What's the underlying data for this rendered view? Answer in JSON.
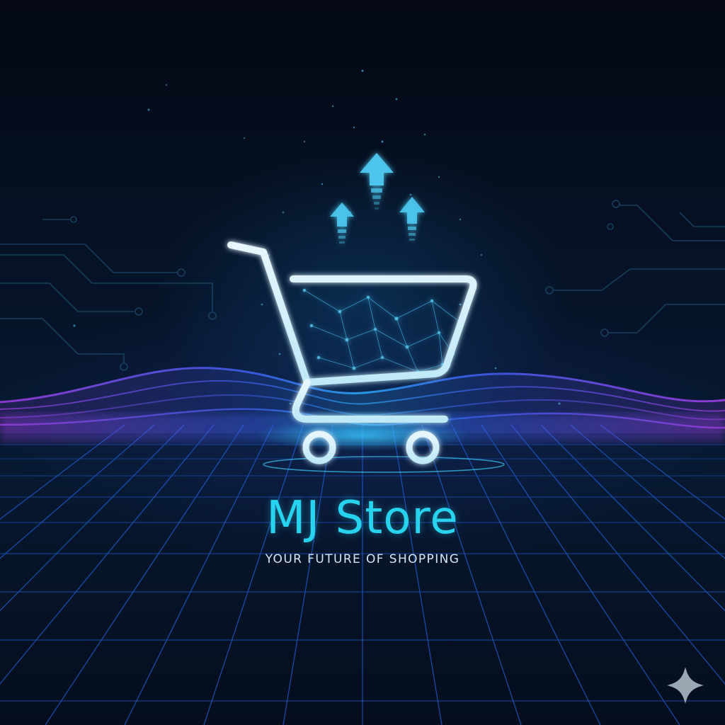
{
  "brand": {
    "name": "MJ Store",
    "tagline": "YOUR FUTURE OF SHOPPING"
  },
  "icons": {
    "logo": "shopping-cart-icon",
    "growth": "arrow-up-icon",
    "watermark": "sparkle-icon"
  },
  "colors": {
    "background": "#050b18",
    "accent_cyan": "#27d3ee",
    "accent_purple": "#8a3cd8",
    "grid_blue": "#1f5fd6",
    "tagline_text": "#d5e6f2"
  }
}
